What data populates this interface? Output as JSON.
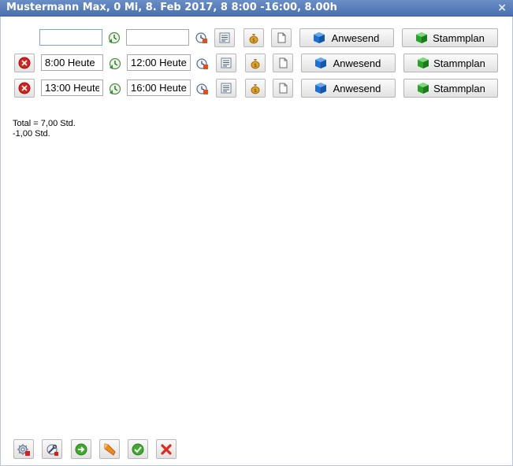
{
  "window": {
    "title": "Mustermann Max, 0 Mi, 8. Feb 2017, 8 8:00 -16:00, 8.00h",
    "close_glyph": "×"
  },
  "rows": [
    {
      "start": "",
      "end": "",
      "has_delete": false,
      "present_label": "Anwesend",
      "plan_label": "Stammplan"
    },
    {
      "start": "8:00 Heute",
      "end": "12:00 Heute",
      "has_delete": true,
      "present_label": "Anwesend",
      "plan_label": "Stammplan"
    },
    {
      "start": "13:00 Heute",
      "end": "16:00 Heute",
      "has_delete": true,
      "present_label": "Anwesend",
      "plan_label": "Stammplan"
    }
  ],
  "summary": {
    "total": "Total = 7,00 Std.",
    "diff": "-1,00 Std."
  },
  "icons": {
    "delete": "delete-icon",
    "start_clock": "start-clock-icon",
    "end_clock": "end-clock-icon",
    "details": "list-icon",
    "money": "money-bag-icon",
    "note": "note-icon",
    "present": "blue-cube-icon",
    "plan": "green-cube-icon"
  },
  "colors": {
    "title_bar": "#4a70b1",
    "delete_red": "#d8201a",
    "present_blue": "#1f6fd1",
    "plan_green": "#2aa32a"
  },
  "toolbar": [
    {
      "name": "settings-button",
      "icon": "gear-icon"
    },
    {
      "name": "tool-button",
      "icon": "wrench-icon"
    },
    {
      "name": "next-button",
      "icon": "arrow-right-icon"
    },
    {
      "name": "flag-button",
      "icon": "flag-icon"
    },
    {
      "name": "confirm-button",
      "icon": "check-icon"
    },
    {
      "name": "cancel-button",
      "icon": "cross-icon"
    }
  ]
}
